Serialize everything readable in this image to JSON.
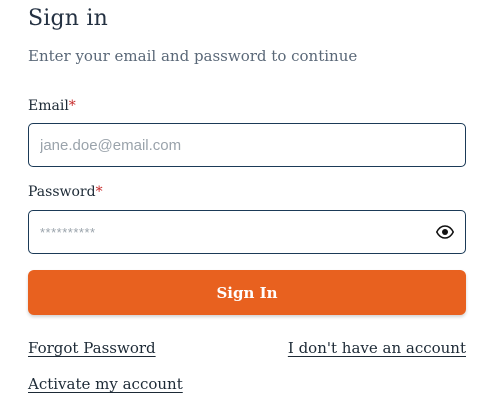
{
  "header": {
    "title": "Sign in",
    "subtitle": "Enter your email and password to continue"
  },
  "form": {
    "email": {
      "label": "Email",
      "required_marker": "*",
      "placeholder": "jane.doe@email.com",
      "value": ""
    },
    "password": {
      "label": "Password",
      "required_marker": "*",
      "placeholder": "**********",
      "value": "",
      "toggle_icon": "eye-icon"
    },
    "submit_label": "Sign In"
  },
  "links": {
    "forgot_password": "Forgot Password",
    "no_account": "I don't have an account",
    "activate_account": "Activate my account"
  },
  "colors": {
    "accent": "#e8611f",
    "field_border": "#1b3a57",
    "required": "#c62828"
  }
}
